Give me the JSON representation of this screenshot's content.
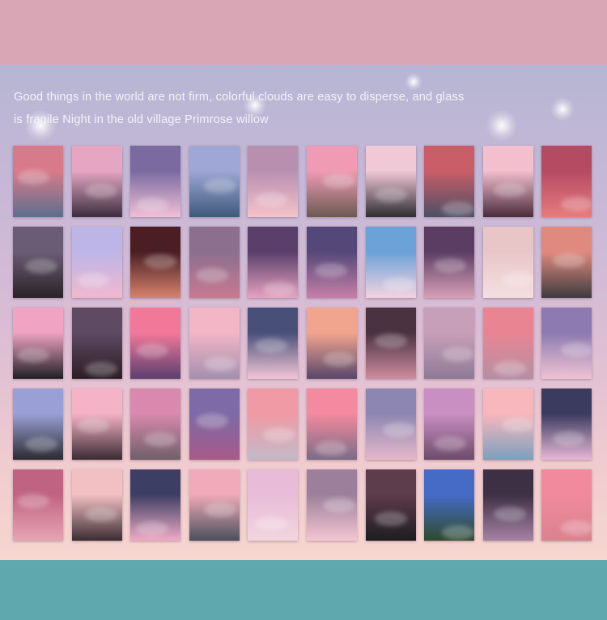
{
  "header": {
    "band_color": "#d9a6b5"
  },
  "caption": {
    "line1": "Good things in the world are not firm, colorful clouds are easy to disperse, and glass",
    "line2": "is fragile Night in the old village Primrose willow"
  },
  "footer": {
    "band_color": "#5fa8ad"
  },
  "sticker_grid": {
    "rows": 5,
    "columns": 10,
    "stickers": [
      {
        "id": "r1c1",
        "top": "#d97a8a",
        "bottom": "#5d6f8e"
      },
      {
        "id": "r1c2",
        "top": "#e6a6c2",
        "bottom": "#3b2f3f"
      },
      {
        "id": "r1c3",
        "top": "#7a6aa0",
        "bottom": "#f0bfd5"
      },
      {
        "id": "r1c4",
        "top": "#9ea7d6",
        "bottom": "#3e5a7a"
      },
      {
        "id": "r1c5",
        "top": "#b98fb0",
        "bottom": "#f5c2c9"
      },
      {
        "id": "r1c6",
        "top": "#f09bb3",
        "bottom": "#6b5a52"
      },
      {
        "id": "r1c7",
        "top": "#f1c9d6",
        "bottom": "#2f2d33"
      },
      {
        "id": "r1c8",
        "top": "#c95e68",
        "bottom": "#4d4f66"
      },
      {
        "id": "r1c9",
        "top": "#f3bfcf",
        "bottom": "#4a2c3a"
      },
      {
        "id": "r1c10",
        "top": "#b54b63",
        "bottom": "#e67b7c"
      },
      {
        "id": "r2c1",
        "top": "#6a5c74",
        "bottom": "#2a2326"
      },
      {
        "id": "r2c2",
        "top": "#bdb5e6",
        "bottom": "#f1b8cf"
      },
      {
        "id": "r2c3",
        "top": "#4a1e22",
        "bottom": "#d6826c"
      },
      {
        "id": "r2c4",
        "top": "#8c6f8e",
        "bottom": "#c77a90"
      },
      {
        "id": "r2c5",
        "top": "#5a3f6a",
        "bottom": "#e6a1bf"
      },
      {
        "id": "r2c6",
        "top": "#544879",
        "bottom": "#c67fa7"
      },
      {
        "id": "r2c7",
        "top": "#6ba2d8",
        "bottom": "#f3d3e0"
      },
      {
        "id": "r2c8",
        "top": "#5b3d63",
        "bottom": "#d8a0b8"
      },
      {
        "id": "r2c9",
        "top": "#e8c6c8",
        "bottom": "#f5dfe1"
      },
      {
        "id": "r2c10",
        "top": "#e08a7f",
        "bottom": "#3e3b40"
      },
      {
        "id": "r3c1",
        "top": "#f0a3c3",
        "bottom": "#1f1f24"
      },
      {
        "id": "r3c2",
        "top": "#5e4a63",
        "bottom": "#2b1c24"
      },
      {
        "id": "r3c3",
        "top": "#f2789a",
        "bottom": "#5b3f6f"
      },
      {
        "id": "r3c4",
        "top": "#f2b6c6",
        "bottom": "#a38fb0"
      },
      {
        "id": "r3c5",
        "top": "#48507a",
        "bottom": "#f3c5d5"
      },
      {
        "id": "r3c6",
        "top": "#f1a58e",
        "bottom": "#59466a"
      },
      {
        "id": "r3c7",
        "top": "#4a3240",
        "bottom": "#cf8ba0"
      },
      {
        "id": "r3c8",
        "top": "#c89fb8",
        "bottom": "#8f7a95"
      },
      {
        "id": "r3c9",
        "top": "#e98593",
        "bottom": "#b58fa3"
      },
      {
        "id": "r3c10",
        "top": "#8d7ab0",
        "bottom": "#f0c3d3"
      },
      {
        "id": "r4c1",
        "top": "#9aa0d5",
        "bottom": "#2c2b31"
      },
      {
        "id": "r4c2",
        "top": "#f4b3c6",
        "bottom": "#3b2b33"
      },
      {
        "id": "r4c3",
        "top": "#d889ad",
        "bottom": "#6f5f68"
      },
      {
        "id": "r4c4",
        "top": "#7d6aa6",
        "bottom": "#a85a88"
      },
      {
        "id": "r4c5",
        "top": "#f09aa6",
        "bottom": "#c3b9c7"
      },
      {
        "id": "r4c6",
        "top": "#f38aa0",
        "bottom": "#7b6b86"
      },
      {
        "id": "r4c7",
        "top": "#8d86b2",
        "bottom": "#e6b8ca"
      },
      {
        "id": "r4c8",
        "top": "#c98fc2",
        "bottom": "#6d4b6a"
      },
      {
        "id": "r4c9",
        "top": "#f8b7bd",
        "bottom": "#7ba0bd"
      },
      {
        "id": "r4c10",
        "top": "#3b3a5f",
        "bottom": "#e7b8d6"
      },
      {
        "id": "r5c1",
        "top": "#c06382",
        "bottom": "#e7a5b4"
      },
      {
        "id": "r5c2",
        "top": "#f2bfc2",
        "bottom": "#3b2d33"
      },
      {
        "id": "r5c3",
        "top": "#3c3e63",
        "bottom": "#f0aac5"
      },
      {
        "id": "r5c4",
        "top": "#f0aab9",
        "bottom": "#4a4f5c"
      },
      {
        "id": "r5c5",
        "top": "#e8bcd8",
        "bottom": "#f2d5de"
      },
      {
        "id": "r5c6",
        "top": "#9c7f9a",
        "bottom": "#f4c6d2"
      },
      {
        "id": "r5c7",
        "top": "#5d3c4b",
        "bottom": "#1d1d22"
      },
      {
        "id": "r5c8",
        "top": "#466bc7",
        "bottom": "#2e4a2c"
      },
      {
        "id": "r5c9",
        "top": "#3d2f44",
        "bottom": "#a783a4"
      },
      {
        "id": "r5c10",
        "top": "#f08a9c",
        "bottom": "#d9828f"
      }
    ]
  }
}
